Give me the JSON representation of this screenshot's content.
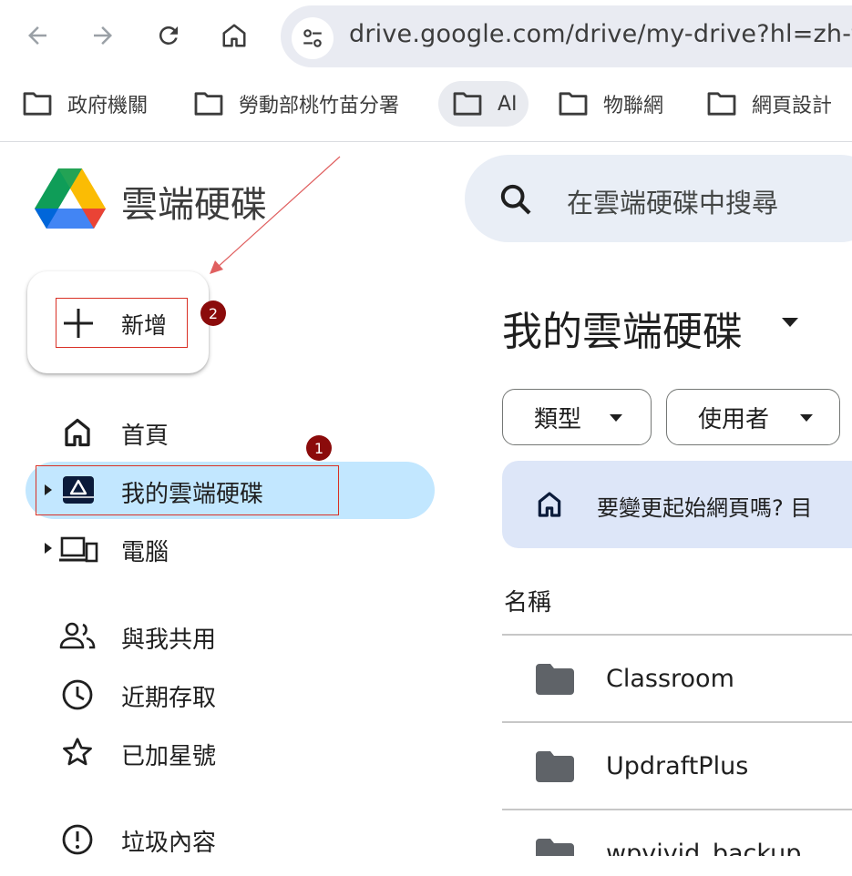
{
  "browser": {
    "url": "drive.google.com/drive/my-drive?hl=zh-tw",
    "bookmarks": [
      {
        "label": "政府機關"
      },
      {
        "label": "勞動部桃竹苗分署"
      },
      {
        "label": "AI"
      },
      {
        "label": "物聯網"
      },
      {
        "label": "網頁設計"
      }
    ]
  },
  "app": {
    "name": "雲端硬碟"
  },
  "new_button": {
    "label": "新增"
  },
  "annotations": {
    "badge_1": "1",
    "badge_2": "2",
    "box_color": "#d93025",
    "badge_color": "#8b0b0b"
  },
  "sidebar": {
    "items": [
      {
        "label": "首頁",
        "icon": "home-icon"
      },
      {
        "label": "我的雲端硬碟",
        "icon": "my-drive-icon",
        "active": true
      },
      {
        "label": "電腦",
        "icon": "computer-icon"
      },
      {
        "label": "與我共用",
        "icon": "people-icon"
      },
      {
        "label": "近期存取",
        "icon": "clock-icon"
      },
      {
        "label": "已加星號",
        "icon": "star-icon"
      },
      {
        "label": "垃圾內容",
        "icon": "spam-icon"
      }
    ]
  },
  "search": {
    "placeholder": "在雲端硬碟中搜尋"
  },
  "main": {
    "title": "我的雲端硬碟",
    "filters": [
      {
        "label": "類型"
      },
      {
        "label": "使用者"
      }
    ],
    "banner": {
      "text": "要變更起始網頁嗎? 目"
    },
    "column_header": "名稱",
    "files": [
      {
        "name": "Classroom",
        "icon": "folder-icon"
      },
      {
        "name": "UpdraftPlus",
        "icon": "folder-icon"
      },
      {
        "name": "wpvivid_backup",
        "icon": "folder-icon"
      }
    ]
  },
  "colors": {
    "active_nav": "#c2e7ff",
    "banner_bg": "#dde6f8",
    "search_bg": "#e9eef6"
  }
}
